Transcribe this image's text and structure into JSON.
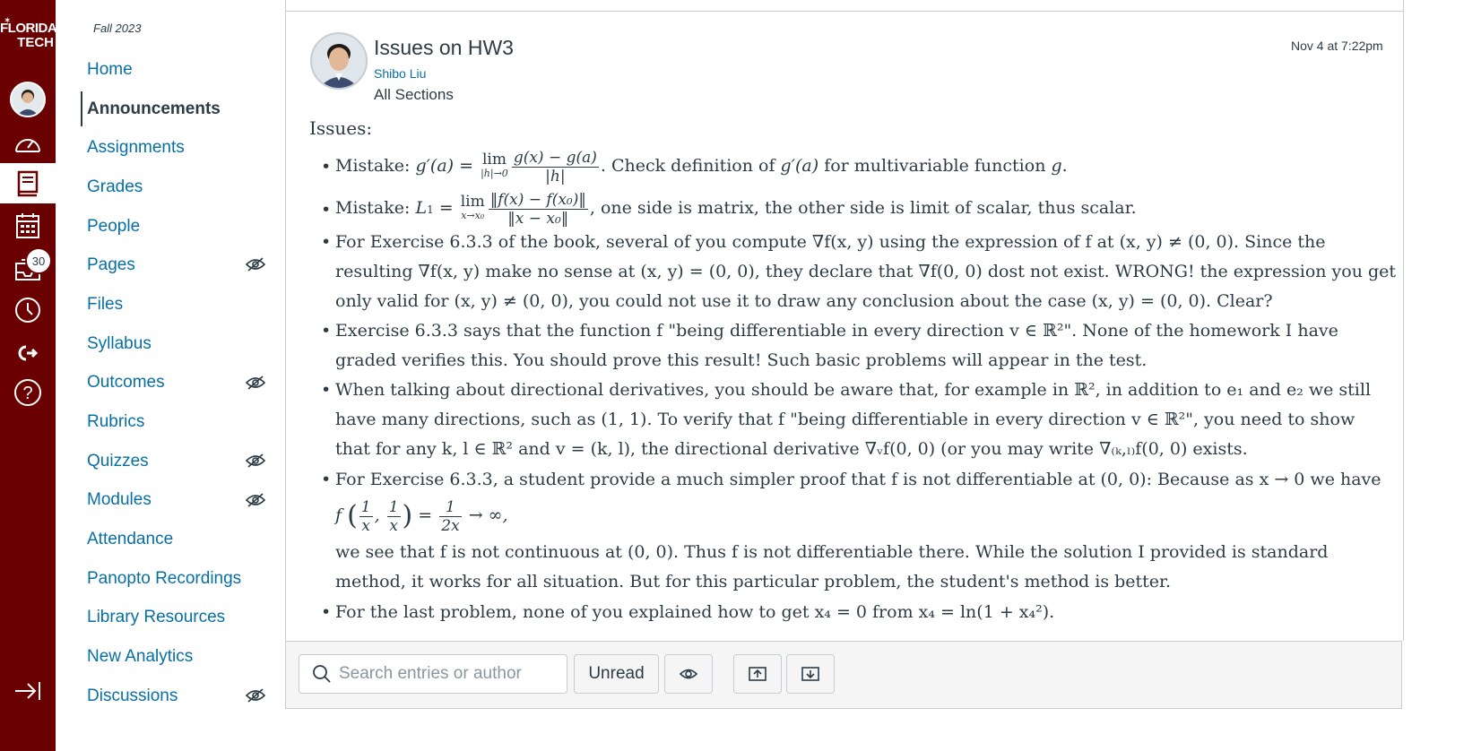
{
  "global_nav": {
    "logo_line1": "FLORIDA",
    "logo_line2": "TECH",
    "inbox_badge": "30",
    "items": [
      "account",
      "dashboard",
      "courses",
      "calendar",
      "inbox",
      "history",
      "commons",
      "help",
      "collapse"
    ]
  },
  "course_nav": {
    "term": "Fall 2023",
    "items": [
      {
        "label": "Home",
        "hidden": false
      },
      {
        "label": "Announcements",
        "hidden": false,
        "active": true
      },
      {
        "label": "Assignments",
        "hidden": false
      },
      {
        "label": "Grades",
        "hidden": false
      },
      {
        "label": "People",
        "hidden": false
      },
      {
        "label": "Pages",
        "hidden": true
      },
      {
        "label": "Files",
        "hidden": false
      },
      {
        "label": "Syllabus",
        "hidden": false
      },
      {
        "label": "Outcomes",
        "hidden": true
      },
      {
        "label": "Rubrics",
        "hidden": false
      },
      {
        "label": "Quizzes",
        "hidden": true
      },
      {
        "label": "Modules",
        "hidden": true
      },
      {
        "label": "Attendance",
        "hidden": false
      },
      {
        "label": "Panopto Recordings",
        "hidden": false
      },
      {
        "label": "Library Resources",
        "hidden": false
      },
      {
        "label": "New Analytics",
        "hidden": false
      },
      {
        "label": "Discussions",
        "hidden": true
      }
    ]
  },
  "post": {
    "title": "Issues on HW3",
    "author": "Shibo Liu",
    "sections": "All Sections",
    "date": "Nov 4 at 7:22pm",
    "heading": "Issues:",
    "b1": {
      "a": "Mistake: ",
      "b": ". Check definition of ",
      "c": " for multivariable function ",
      "d": "."
    },
    "b2": {
      "a": "Mistake: ",
      "b": ", one side is matrix, the other side is limit of scalar, thus scalar."
    },
    "b3": {
      "l1": "For Exercise 6.3.3 of the book, several of you compute ∇f(x, y) using the expression of f at (x, y) ≠ (0, 0). Since the",
      "l2": "resulting ∇f(x, y) make no sense at (x, y) = (0, 0), they declare that ∇f(0, 0) dost not exist. WRONG! the expression you get",
      "l3": "only valid for (x, y) ≠ (0, 0), you could not use it to draw any conclusion about the case (x, y) = (0, 0). Clear?"
    },
    "b4": {
      "l1": "Exercise 6.3.3 says that the function f \"being differentiable in every direction v ∈ ℝ²\". None of the homework I have",
      "l2": "graded verifies this. You should prove this result! Such basic problems will appear in the test."
    },
    "b5": {
      "l1": "When talking about directional derivatives, you should be aware that, for example in ℝ², in addition to e₁ and e₂ we still",
      "l2": "have many directions, such as (1, 1). To verify that f \"being differentiable in every direction v ∈ ℝ²\", you need to show",
      "l3": "that for any k, l ∈ ℝ² and v = (k, l), the directional derivative ∇ᵥf(0, 0) (or you may write ∇₍ₖ,ₗ₎f(0, 0) exists."
    },
    "b6": {
      "l1": "For Exercise 6.3.3, a student provide a much simpler proof that f is not differentiable at (0, 0): Because as x → 0 we have",
      "l3": "we see that f is not continuous at (0, 0). Thus f is not differentiable there. While the solution I provided is standard",
      "l4": "method, it works for all situation. But for this particular problem, the student's method is better."
    },
    "b7": {
      "l1": "For the last problem, none of you explained how to get x₄ = 0 from x₄ = ln(1 + x₄²)."
    }
  },
  "toolbar": {
    "search_placeholder": "Search entries or author",
    "unread_label": "Unread"
  }
}
